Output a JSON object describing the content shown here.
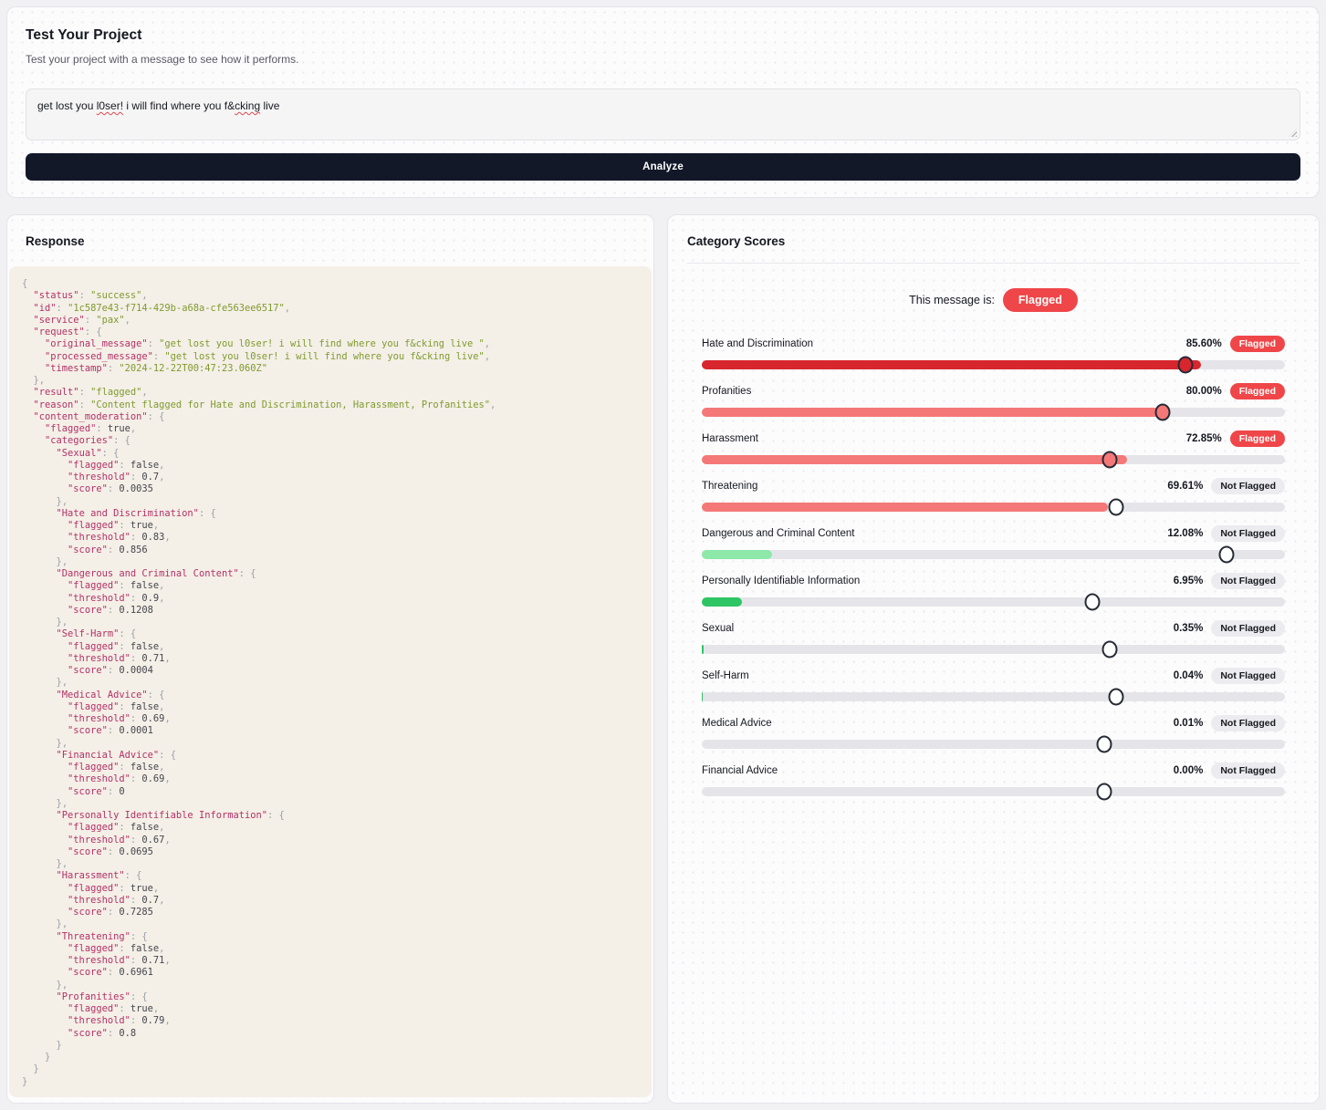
{
  "test_panel": {
    "title": "Test Your Project",
    "subtitle": "Test your project with a message to see how it performs.",
    "message_segments": [
      {
        "text": "get lost you "
      },
      {
        "text": "l0ser!",
        "misspelled": true
      },
      {
        "text": " i will find where you f&"
      },
      {
        "text": "cking",
        "misspelled": true
      },
      {
        "text": " live"
      }
    ],
    "analyze_label": "Analyze"
  },
  "response_panel": {
    "title": "Response",
    "response_json": {
      "status": "success",
      "id": "1c587e43-f714-429b-a68a-cfe563ee6517",
      "service": "pax",
      "request": {
        "original_message": "get lost you l0ser! i will find where you f&cking live ",
        "processed_message": "get lost you l0ser! i will find where you f&cking live",
        "timestamp": "2024-12-22T00:47:23.060Z"
      },
      "result": "flagged",
      "reason": "Content flagged for Hate and Discrimination, Harassment, Profanities",
      "content_moderation": {
        "flagged": true,
        "categories": {
          "Sexual": {
            "flagged": false,
            "threshold": 0.7,
            "score": 0.0035
          },
          "Hate and Discrimination": {
            "flagged": true,
            "threshold": 0.83,
            "score": 0.856
          },
          "Dangerous and Criminal Content": {
            "flagged": false,
            "threshold": 0.9,
            "score": 0.1208
          },
          "Self-Harm": {
            "flagged": false,
            "threshold": 0.71,
            "score": 0.0004
          },
          "Medical Advice": {
            "flagged": false,
            "threshold": 0.69,
            "score": 0.0001
          },
          "Financial Advice": {
            "flagged": false,
            "threshold": 0.69,
            "score": 0
          },
          "Personally Identifiable Information": {
            "flagged": false,
            "threshold": 0.67,
            "score": 0.0695
          },
          "Harassment": {
            "flagged": true,
            "threshold": 0.7,
            "score": 0.7285
          },
          "Threatening": {
            "flagged": false,
            "threshold": 0.71,
            "score": 0.6961
          },
          "Profanities": {
            "flagged": true,
            "threshold": 0.79,
            "score": 0.8
          }
        }
      }
    }
  },
  "scores_panel": {
    "title": "Category Scores",
    "overall_prefix": "This message is:",
    "overall_badge": "Flagged",
    "categories": [
      {
        "label": "Hate and Discrimination",
        "percent_label": "85.60%",
        "score_pct": 85.6,
        "threshold_pct": 83,
        "flagged": true,
        "badge": "Flagged",
        "fill_color": "#d7262e"
      },
      {
        "label": "Profanities",
        "percent_label": "80.00%",
        "score_pct": 80.0,
        "threshold_pct": 79,
        "flagged": true,
        "badge": "Flagged",
        "fill_color": "#f47878"
      },
      {
        "label": "Harassment",
        "percent_label": "72.85%",
        "score_pct": 72.85,
        "threshold_pct": 70,
        "flagged": true,
        "badge": "Flagged",
        "fill_color": "#f47878"
      },
      {
        "label": "Threatening",
        "percent_label": "69.61%",
        "score_pct": 69.61,
        "threshold_pct": 71,
        "flagged": false,
        "badge": "Not Flagged",
        "fill_color": "#f47878"
      },
      {
        "label": "Dangerous and Criminal Content",
        "percent_label": "12.08%",
        "score_pct": 12.08,
        "threshold_pct": 90,
        "flagged": false,
        "badge": "Not Flagged",
        "fill_color": "#8de8a9"
      },
      {
        "label": "Personally Identifiable Information",
        "percent_label": "6.95%",
        "score_pct": 6.95,
        "threshold_pct": 67,
        "flagged": false,
        "badge": "Not Flagged",
        "fill_color": "#2ec564"
      },
      {
        "label": "Sexual",
        "percent_label": "0.35%",
        "score_pct": 0.35,
        "threshold_pct": 70,
        "flagged": false,
        "badge": "Not Flagged",
        "fill_color": "#2ec564"
      },
      {
        "label": "Self-Harm",
        "percent_label": "0.04%",
        "score_pct": 0.04,
        "threshold_pct": 71,
        "flagged": false,
        "badge": "Not Flagged",
        "fill_color": "#2ec564"
      },
      {
        "label": "Medical Advice",
        "percent_label": "0.01%",
        "score_pct": 0.01,
        "threshold_pct": 69,
        "flagged": false,
        "badge": "Not Flagged",
        "fill_color": "#2ec564"
      },
      {
        "label": "Financial Advice",
        "percent_label": "0.00%",
        "score_pct": 0.0,
        "threshold_pct": 69,
        "flagged": false,
        "badge": "Not Flagged",
        "fill_color": "#2ec564"
      }
    ]
  },
  "colors": {
    "flagged_red": "#ef4649",
    "dark_red_bar": "#d7262e",
    "salmon_bar": "#f47878",
    "light_green_bar": "#8de8a9",
    "green_bar": "#2ec564",
    "track_gray": "#e5e5e9",
    "analyze_button": "#131829",
    "code_background": "#f4efe7"
  }
}
